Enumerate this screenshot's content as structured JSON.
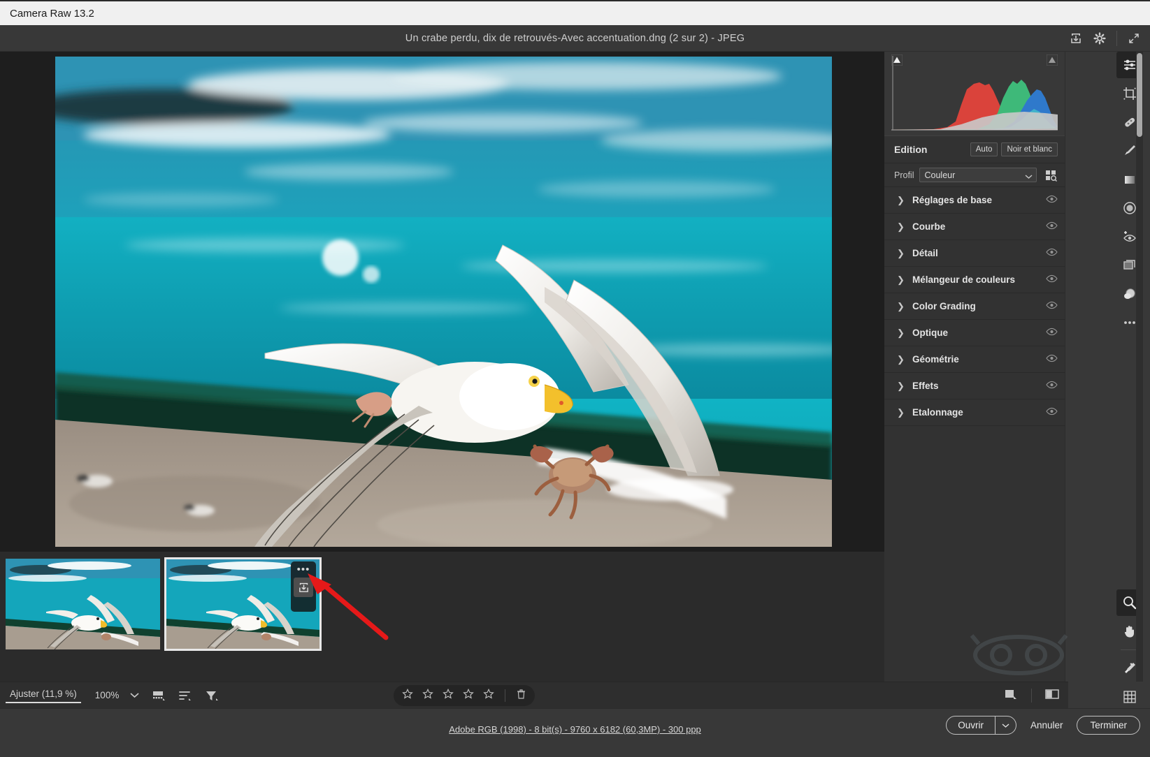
{
  "window": {
    "app_title": "Camera Raw 13.2"
  },
  "header": {
    "doc_title": "Un crabe perdu, dix de retrouvés-Avec accentuation.dng (2 sur 2)  -  JPEG",
    "icons": [
      {
        "name": "save-image-icon",
        "label": "Enregistrer l'image"
      },
      {
        "name": "preferences-gear-icon",
        "label": "Préférences"
      },
      {
        "name": "fullscreen-icon",
        "label": "Plein écran"
      }
    ]
  },
  "panel": {
    "edit_title": "Edition",
    "auto_label": "Auto",
    "bw_label": "Noir et blanc",
    "profile_label": "Profil",
    "profile_value": "Couleur",
    "profile_browser_icon": "profile-browser-icon",
    "sections": [
      {
        "label": "Réglages de base"
      },
      {
        "label": "Courbe"
      },
      {
        "label": "Détail"
      },
      {
        "label": "Mélangeur de couleurs"
      },
      {
        "label": "Color Grading"
      },
      {
        "label": "Optique"
      },
      {
        "label": "Géométrie"
      },
      {
        "label": "Effets"
      },
      {
        "label": "Etalonnage"
      }
    ]
  },
  "rail": {
    "top_tools": [
      {
        "name": "edit-sliders-icon",
        "label": "Modifier",
        "active": true
      },
      {
        "name": "crop-icon",
        "label": "Recadrage"
      },
      {
        "name": "healing-icon",
        "label": "Retouche des tons directs"
      },
      {
        "name": "masking-brush-icon",
        "label": "Masquage"
      },
      {
        "name": "gradient-filter-icon",
        "label": "Filtre gradué"
      },
      {
        "name": "radial-filter-icon",
        "label": "Filtre radial"
      },
      {
        "name": "red-eye-icon",
        "label": "Correction des yeux rouges"
      },
      {
        "name": "presets-icon",
        "label": "Paramètres prédéfinis"
      },
      {
        "name": "snapshots-icon",
        "label": "Instantanés"
      },
      {
        "name": "more-options-icon",
        "label": "Plus"
      }
    ],
    "bottom_tools": [
      {
        "name": "zoom-tool-icon",
        "label": "Zoom",
        "active": true
      },
      {
        "name": "hand-tool-icon",
        "label": "Main"
      },
      {
        "name": "eyedropper-icon",
        "label": "Pipette de balance des blancs"
      },
      {
        "name": "grid-overlay-icon",
        "label": "Grille"
      }
    ]
  },
  "filmstrip": {
    "thumbnails": [
      {
        "name": "thumbnail-1",
        "selected": false
      },
      {
        "name": "thumbnail-2",
        "selected": true
      }
    ],
    "overlay": {
      "more_dots": "•••",
      "save_icon": "save-image-icon"
    }
  },
  "toolbar": {
    "fit_label": "Ajuster (11,9 %)",
    "zoom_value": "100%",
    "zoom_caret_icon": "chevron-down-icon",
    "tools": [
      {
        "name": "filmstrip-thumbnails-icon"
      },
      {
        "name": "sort-order-icon"
      },
      {
        "name": "filter-icon"
      }
    ],
    "rating": {
      "stars": 5,
      "filled": 0,
      "trash_icon": "trash-icon"
    },
    "view_toggles": [
      {
        "name": "single-view-icon"
      },
      {
        "name": "before-after-view-icon"
      }
    ]
  },
  "status": {
    "info_text": "Adobe RGB (1998) - 8 bit(s) - 9760 x 6182 (60,3MP) - 300 ppp",
    "open_label": "Ouvrir",
    "open_caret_icon": "chevron-down-icon",
    "cancel_label": "Annuler",
    "done_label": "Terminer"
  },
  "histogram": {
    "shadow_clip_icon": "shadow-clipping-icon",
    "highlight_clip_icon": "highlight-clipping-icon",
    "channels": [
      "red",
      "green",
      "blue",
      "luminance"
    ]
  },
  "colors": {
    "panel_bg": "#323232",
    "app_bg": "#383838",
    "canvas_bg": "#1e1e1e",
    "text": "#e2e2e2",
    "accent_red": "#e02020",
    "histogram_red": "#e8453c",
    "histogram_green": "#3fc47f",
    "histogram_blue": "#2f7fd8",
    "histogram_cyan": "#44c8d8"
  }
}
